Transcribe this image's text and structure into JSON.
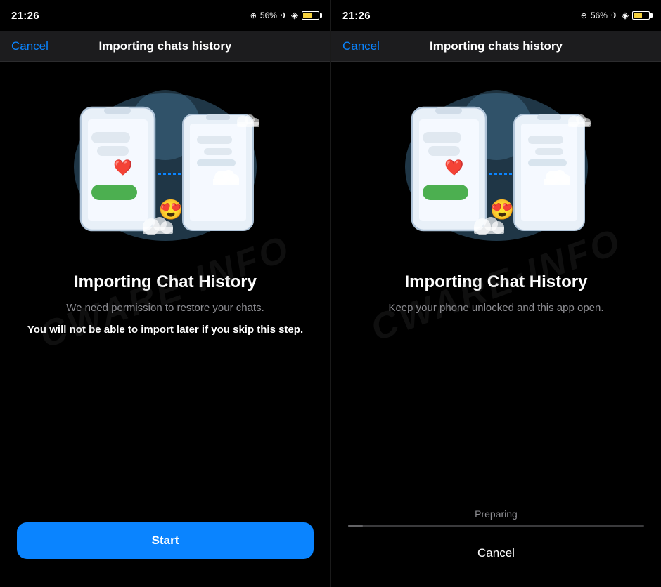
{
  "left_screen": {
    "status_bar": {
      "time": "21:26",
      "battery_percent": "56%",
      "location_icon": "location",
      "airplane_icon": "airplane",
      "wifi_icon": "wifi"
    },
    "nav": {
      "cancel_label": "Cancel",
      "title": "Importing chats history"
    },
    "illustration": {
      "alt": "Two phones transferring chat history with heart and emoji"
    },
    "main_title": "Importing Chat History",
    "subtitle": "We need permission to restore your chats.",
    "warning": "You will not be able to import later if you skip this step.",
    "start_button_label": "Start",
    "watermark": "CWARE·INFO"
  },
  "right_screen": {
    "status_bar": {
      "time": "21:26",
      "battery_percent": "56%",
      "location_icon": "location",
      "airplane_icon": "airplane",
      "wifi_icon": "wifi"
    },
    "nav": {
      "cancel_label": "Cancel",
      "title": "Importing chats history"
    },
    "illustration": {
      "alt": "Two phones transferring chat history with heart and emoji"
    },
    "main_title": "Importing Chat History",
    "subtitle": "Keep your phone unlocked and this app open.",
    "preparing_label": "Preparing",
    "cancel_button_label": "Cancel",
    "watermark": "CWARE·INFO"
  }
}
